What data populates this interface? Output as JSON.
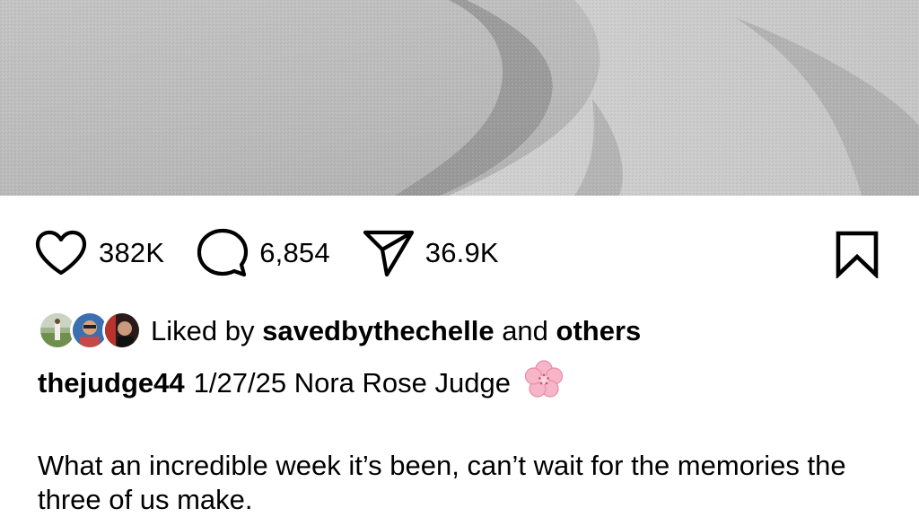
{
  "post": {
    "likes": "382K",
    "comments": "6,854",
    "shares": "36.9K"
  },
  "liked_by": {
    "prefix": "Liked by",
    "user": "savedbythechelle",
    "joiner": "and",
    "others": "others"
  },
  "caption": {
    "username": "thejudge44",
    "headline": "1/27/25 Nora Rose Judge",
    "body": "What an incredible week it’s been, can’t wait for the memories the three of us make."
  },
  "icons": {
    "like": "heart-icon",
    "comment": "comment-bubble-icon",
    "share": "paper-plane-icon",
    "save": "bookmark-icon",
    "emoji": "cherry-blossom-emoji"
  },
  "colors": {
    "text": "#000000",
    "background": "#ffffff",
    "photo_gray": "#b8b8b8"
  }
}
